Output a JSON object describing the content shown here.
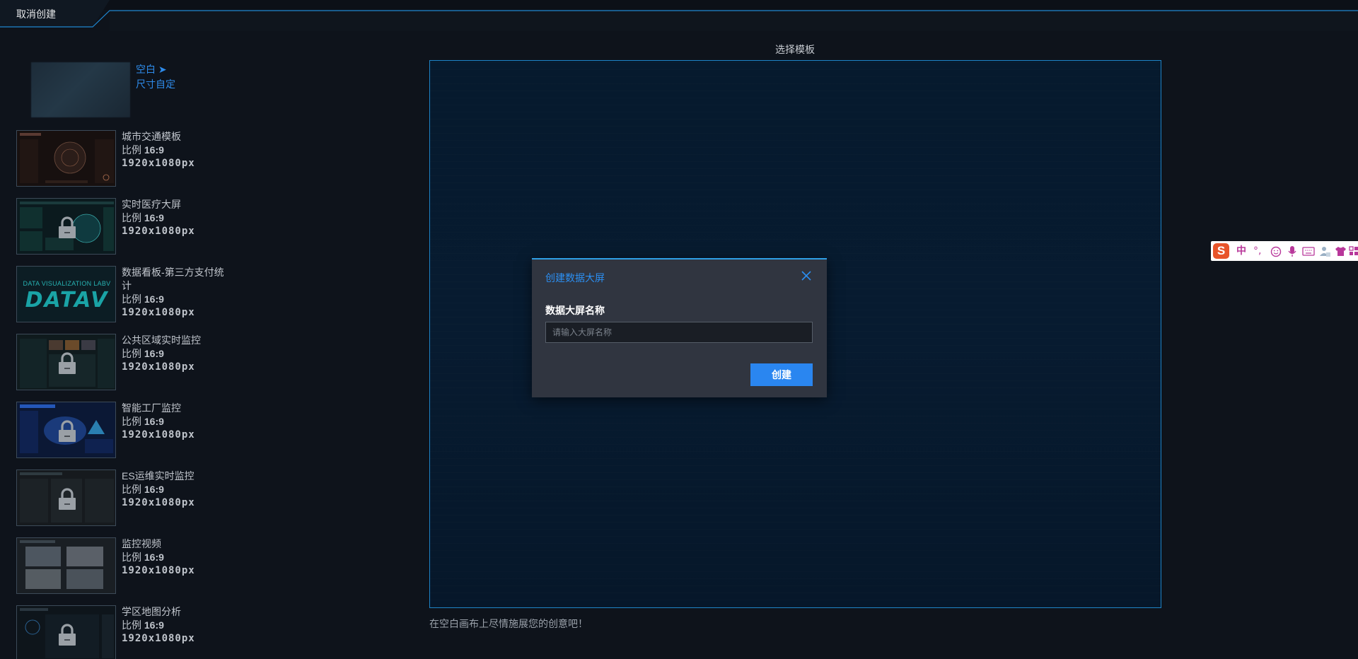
{
  "topbar": {
    "cancel_label": "取消创建"
  },
  "blank_template": {
    "title": "空白 ➤",
    "subtitle": "尺寸自定"
  },
  "templates": [
    {
      "name": "城市交通模板",
      "ratio_prefix": "比例 ",
      "ratio": "16:9",
      "size": "1920x1080px",
      "locked": false
    },
    {
      "name": "实时医疗大屏",
      "ratio_prefix": "比例 ",
      "ratio": "16:9",
      "size": "1920x1080px",
      "locked": true
    },
    {
      "name": "数据看板-第三方支付统计",
      "ratio_prefix": "比例 ",
      "ratio": "16:9",
      "size": "1920x1080px",
      "locked": false
    },
    {
      "name": "公共区域实时监控",
      "ratio_prefix": "比例 ",
      "ratio": "16:9",
      "size": "1920x1080px",
      "locked": true
    },
    {
      "name": "智能工厂监控",
      "ratio_prefix": "比例 ",
      "ratio": "16:9",
      "size": "1920x1080px",
      "locked": true
    },
    {
      "name": "ES运维实时监控",
      "ratio_prefix": "比例 ",
      "ratio": "16:9",
      "size": "1920x1080px",
      "locked": true
    },
    {
      "name": "监控视频",
      "ratio_prefix": "比例 ",
      "ratio": "16:9",
      "size": "1920x1080px",
      "locked": false
    },
    {
      "name": "学区地图分析",
      "ratio_prefix": "比例 ",
      "ratio": "16:9",
      "size": "1920x1080px",
      "locked": true
    }
  ],
  "datav_thumb": {
    "line1": "DATA VISUALIZATION LABV",
    "logo": "DATAV"
  },
  "canvas": {
    "title": "选择模板",
    "hint": "在空白画布上尽情施展您的创意吧！"
  },
  "dialog": {
    "title": "创建数据大屏",
    "field_label": "数据大屏名称",
    "input_value": "",
    "input_placeholder": "请输入大屏名称",
    "create_label": "创建"
  },
  "ime": {
    "logo": "S",
    "mode": "中",
    "punct": "°,"
  },
  "colors": {
    "accent": "#2b8ff2",
    "border": "#1d83c6",
    "bg": "#0e131b",
    "canvas_bg": "#061a2e",
    "dialog_bg": "#303540",
    "ime_icon": "#b8379a"
  }
}
